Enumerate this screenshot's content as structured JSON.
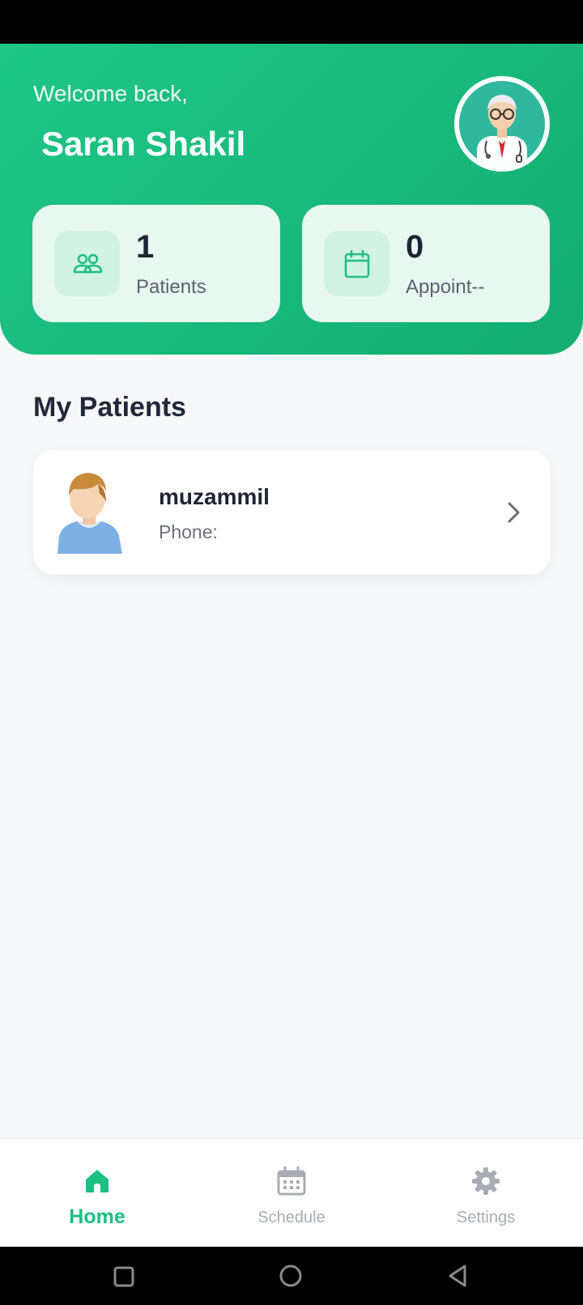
{
  "header": {
    "welcome_text": "Welcome back,",
    "doctor_name": "Saran Shakil",
    "avatar_icon": "doctor-avatar-icon"
  },
  "stats": {
    "patients": {
      "value": "1",
      "label": "Patients",
      "icon": "people-icon"
    },
    "appointments": {
      "value": "0",
      "label": "Appoint--",
      "icon": "calendar-icon"
    }
  },
  "section": {
    "title": "My Patients"
  },
  "patients": [
    {
      "name": "muzammil",
      "phone_label": "Phone:",
      "avatar_icon": "patient-avatar-icon"
    }
  ],
  "bottom_nav": {
    "items": [
      {
        "label": "Home",
        "icon": "home-icon",
        "active": true
      },
      {
        "label": "Schedule",
        "icon": "calendar-grid-icon",
        "active": false
      },
      {
        "label": "Settings",
        "icon": "gear-icon",
        "active": false
      }
    ]
  },
  "colors": {
    "accent": "#1cbf82",
    "header_gradient_start": "#1fc787",
    "header_gradient_end": "#14ad72",
    "inactive_nav": "#a8acb4"
  }
}
